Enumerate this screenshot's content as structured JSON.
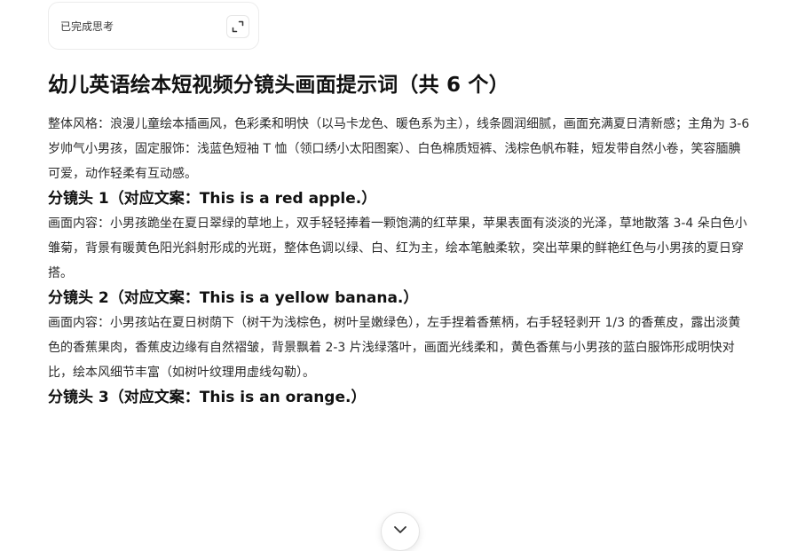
{
  "thinking": {
    "label": "已完成思考",
    "expand_icon": "expand-icon"
  },
  "title": "幼儿英语绘本短视频分镜头画面提示词（共 6 个）",
  "intro": "整体风格：浪漫儿童绘本插画风，色彩柔和明快（以马卡龙色、暖色系为主），线条圆润细腻，画面充满夏日清新感；主角为 3-6 岁帅气小男孩，固定服饰：浅蓝色短袖 T 恤（领口绣小太阳图案）、白色棉质短裤、浅棕色帆布鞋，短发带自然小卷，笑容腼腆可爱，动作轻柔有互动感。",
  "shots": [
    {
      "title": "分镜头 1（对应文案：This is a red apple.）",
      "body": "画面内容：小男孩跪坐在夏日翠绿的草地上，双手轻轻捧着一颗饱满的红苹果，苹果表面有淡淡的光泽，草地散落 3-4 朵白色小雏菊，背景有暖黄色阳光斜射形成的光斑，整体色调以绿、白、红为主，绘本笔触柔软，突出苹果的鲜艳红色与小男孩的夏日穿搭。"
    },
    {
      "title": "分镜头 2（对应文案：This is a yellow banana.）",
      "body": "画面内容：小男孩站在夏日树荫下（树干为浅棕色，树叶呈嫩绿色），左手捏着香蕉柄，右手轻轻剥开 1/3 的香蕉皮，露出淡黄色的香蕉果肉，香蕉皮边缘有自然褶皱，背景飘着 2-3 片浅绿落叶，画面光线柔和，黄色香蕉与小男孩的蓝白服饰形成明快对比，绘本风细节丰富（如树叶纹理用虚线勾勒）。"
    },
    {
      "title": "分镜头 3（对应文案：This is an orange.）"
    }
  ],
  "scroll_icon": "chevron-down-icon"
}
